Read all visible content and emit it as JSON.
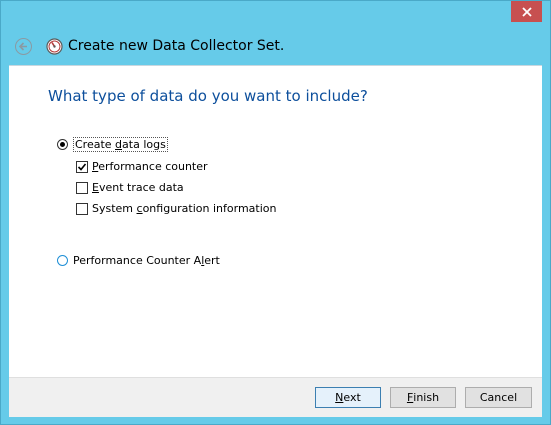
{
  "window": {
    "title": "Create new Data Collector Set.",
    "close_icon": "close-icon",
    "back_icon": "back-arrow-icon",
    "app_icon": "performance-monitor-icon"
  },
  "main": {
    "question": "What type of data do you want to include?",
    "options": {
      "create_data_logs": {
        "pre": "Create ",
        "key": "d",
        "post": "ata logs",
        "selected": true
      },
      "perf_alert": {
        "pre": "Performance Counter A",
        "key": "l",
        "post": "ert",
        "selected": false
      }
    },
    "checkboxes": {
      "performance_counter": {
        "pre": "",
        "key": "P",
        "post": "erformance counter",
        "checked": true
      },
      "event_trace": {
        "pre": "",
        "key": "E",
        "post": "vent trace data",
        "checked": false
      },
      "system_config": {
        "pre": "System ",
        "key": "c",
        "post": "onfiguration information",
        "checked": false
      }
    }
  },
  "footer": {
    "next": {
      "pre": "",
      "key": "N",
      "post": "ext"
    },
    "finish": {
      "pre": "",
      "key": "F",
      "post": "inish"
    },
    "cancel": {
      "label": "Cancel"
    }
  },
  "colors": {
    "chrome": "#66cbe9",
    "close": "#c75050",
    "heading": "#0d4f9c"
  }
}
